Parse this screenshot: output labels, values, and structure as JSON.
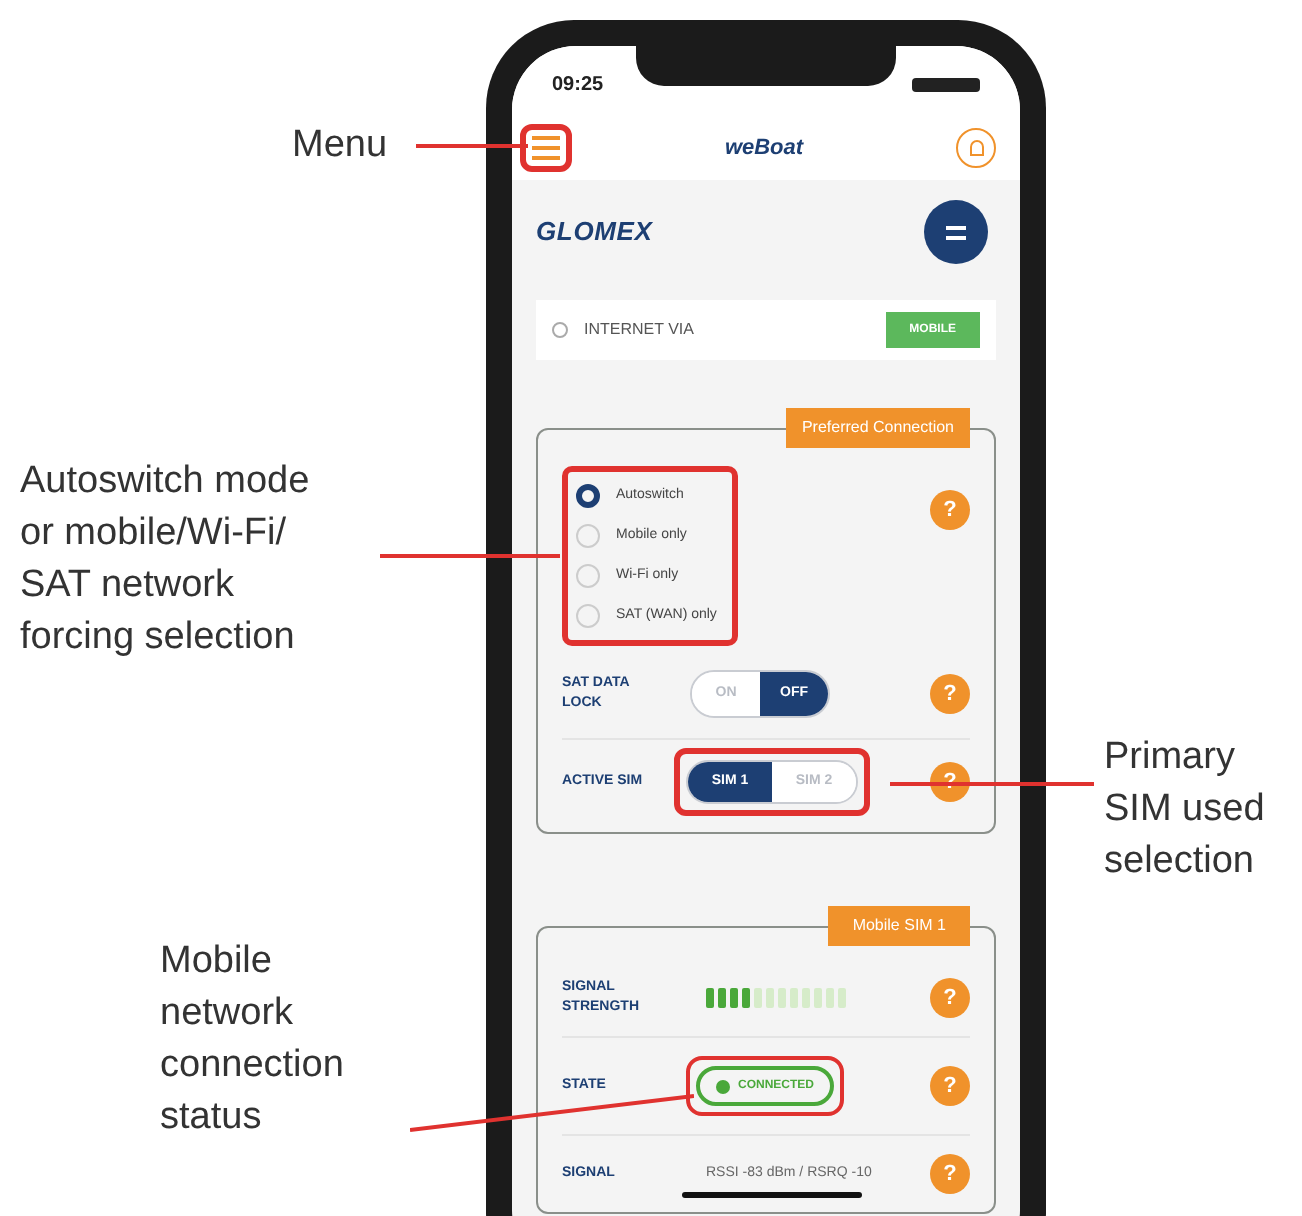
{
  "callouts": [
    {
      "lines": [
        "Menu"
      ]
    },
    {
      "lines": [
        "Autoswitch mode",
        "or mobile/Wi-Fi/",
        "SAT network",
        "forcing selection"
      ]
    },
    {
      "lines": [
        "Primary",
        "SIM used",
        "selection"
      ]
    },
    {
      "lines": [
        "Mobile",
        "network",
        "connection",
        "status"
      ]
    }
  ],
  "phone": {
    "status_bar": {
      "time": "09:25"
    },
    "header": {
      "logo": "weBoat"
    },
    "brand": {
      "logo": "GLOMEX"
    },
    "internet": {
      "label": "INTERNET VIA",
      "value": "MOBILE"
    },
    "preferred": {
      "title": "Preferred Connection",
      "help": "?",
      "modes": [
        {
          "label": "Autoswitch",
          "selected": true
        },
        {
          "label": "Mobile only",
          "selected": false
        },
        {
          "label": "Wi-Fi only",
          "selected": false
        },
        {
          "label": "SAT (WAN) only",
          "selected": false
        }
      ],
      "sat_lock": {
        "label": "SAT DATA LOCK",
        "help": "?",
        "options": [
          {
            "label": "ON",
            "selected": false
          },
          {
            "label": "OFF",
            "selected": true
          }
        ]
      },
      "active_sim": {
        "label": "ACTIVE SIM",
        "help": "?",
        "options": [
          {
            "label": "SIM 1",
            "selected": true
          },
          {
            "label": "SIM 2",
            "selected": false
          }
        ]
      }
    },
    "mobile": {
      "title": "Mobile SIM 1",
      "rows": [
        {
          "kind": "meter",
          "label": "SIGNAL STRENGTH",
          "level": 0.33,
          "help": "?"
        },
        {
          "kind": "status",
          "label": "STATE",
          "value": "CONNECTED",
          "help": "?"
        },
        {
          "kind": "text",
          "label": "SIGNAL",
          "value": "RSSI -83 dBm / RSRQ -10",
          "help": "?"
        }
      ]
    }
  }
}
